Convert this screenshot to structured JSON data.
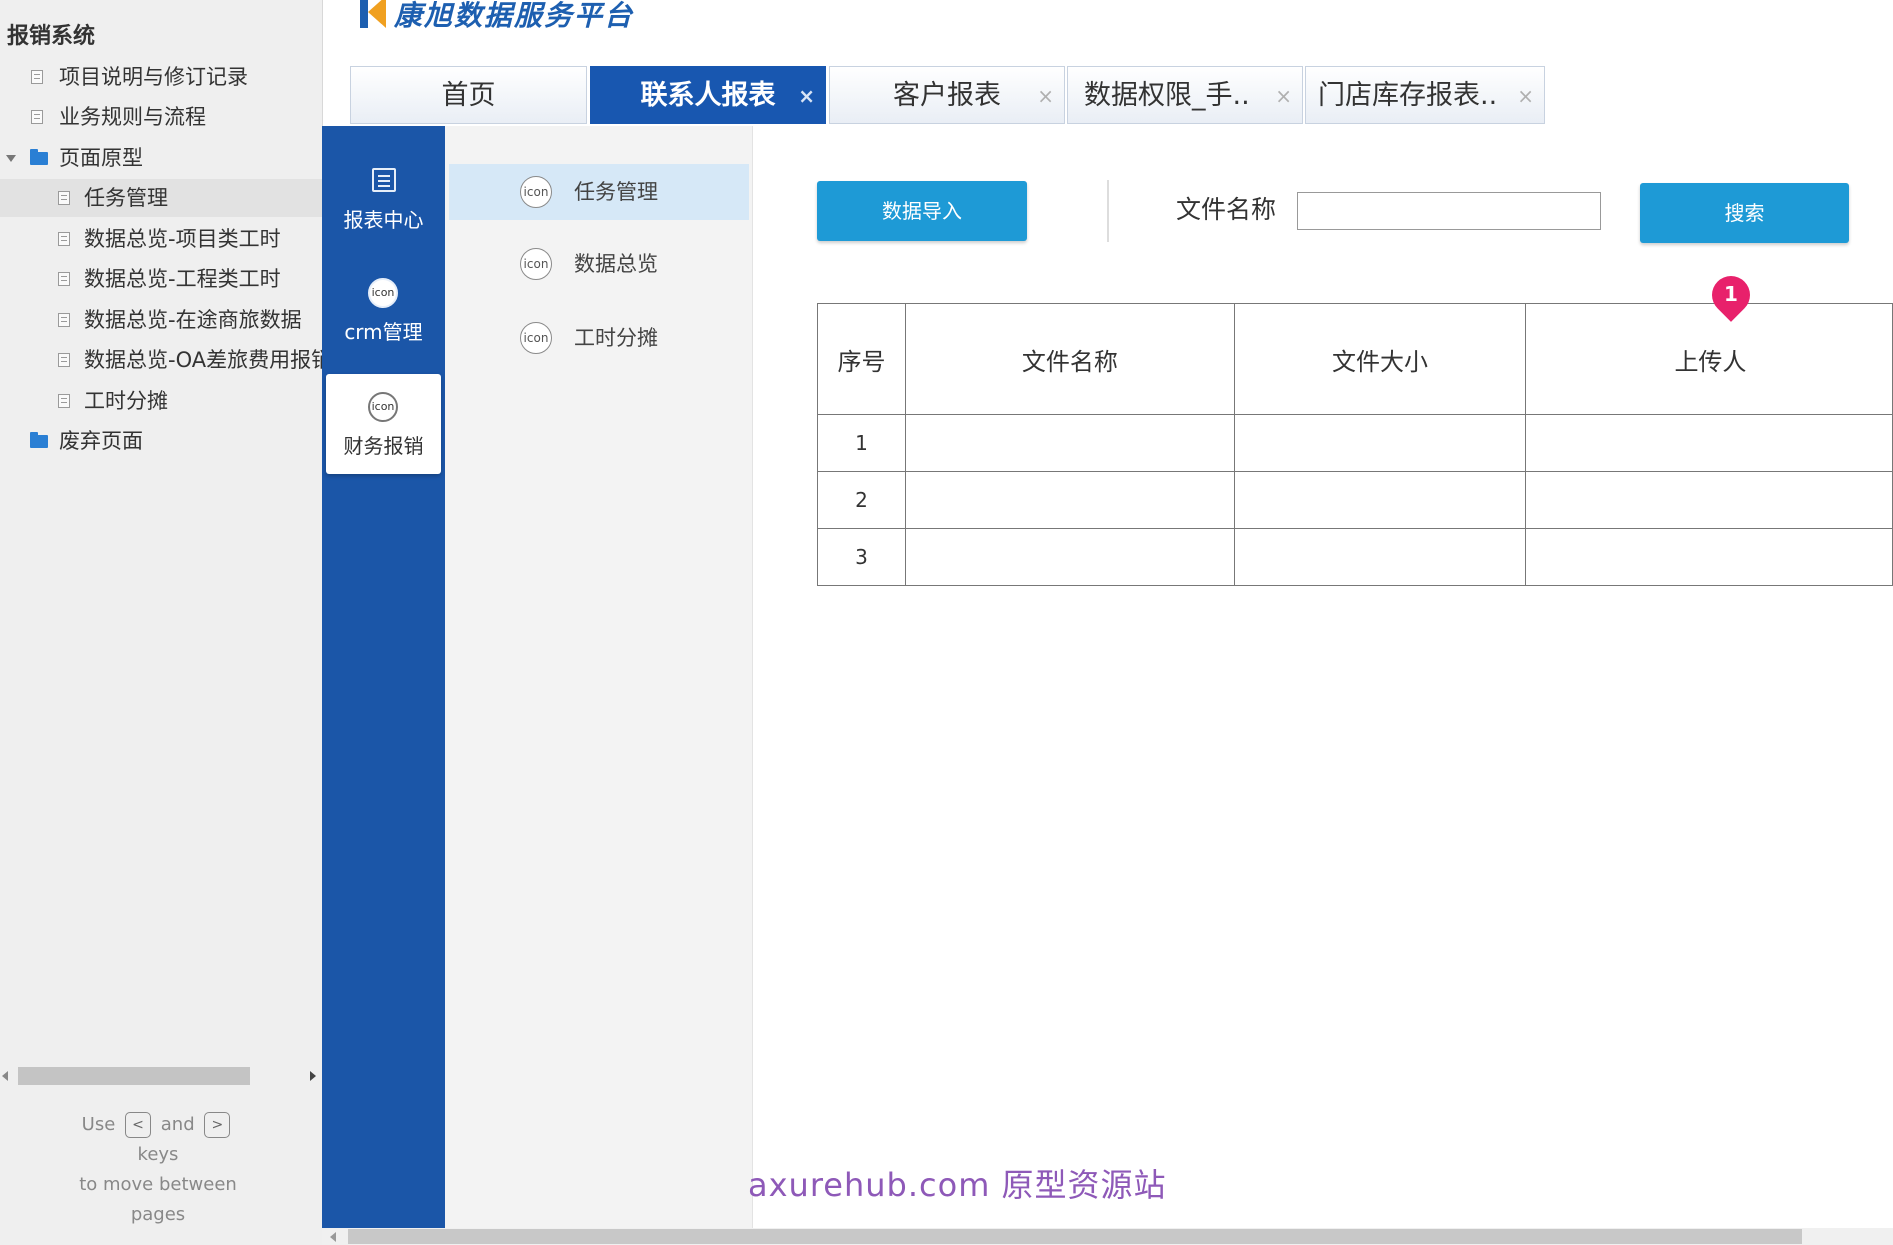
{
  "sitemap": {
    "title": "报销系统",
    "items": [
      {
        "label": "项目说明与修订记录",
        "type": "page"
      },
      {
        "label": "业务规则与流程",
        "type": "page"
      },
      {
        "label": "页面原型",
        "type": "folder"
      },
      {
        "label": "任务管理",
        "type": "page",
        "selected": true
      },
      {
        "label": "数据总览-项目类工时",
        "type": "page"
      },
      {
        "label": "数据总览-工程类工时",
        "type": "page"
      },
      {
        "label": "数据总览-在途商旅数据",
        "type": "page"
      },
      {
        "label": "数据总览-OA差旅费用报销",
        "type": "page"
      },
      {
        "label": "工时分摊",
        "type": "page"
      },
      {
        "label": "废弃页面",
        "type": "folder"
      }
    ],
    "hint": {
      "use": "Use",
      "key_prev": "<",
      "and": "and",
      "key_next": ">",
      "keys": "keys",
      "line3": "to move between",
      "line4": "pages"
    }
  },
  "app": {
    "logo_text": "康旭数据服务平台",
    "tabs": [
      {
        "label": "首页",
        "closable": false,
        "active": false
      },
      {
        "label": "联系人报表",
        "closable": true,
        "active": true
      },
      {
        "label": "客户报表",
        "closable": true,
        "active": false
      },
      {
        "label": "数据权限_手..",
        "closable": true,
        "active": false
      },
      {
        "label": "门店库存报表..",
        "closable": true,
        "active": false
      }
    ],
    "tab_close_glyph": "×",
    "sidenav": [
      {
        "label": "报表中心",
        "icon": "list-icon"
      },
      {
        "label": "crm管理",
        "icon": "icon"
      },
      {
        "label": "财务报销",
        "icon": "icon",
        "active": true
      }
    ],
    "icon_text": "icon",
    "submenu": [
      {
        "label": "任务管理",
        "active": true
      },
      {
        "label": "数据总览"
      },
      {
        "label": "工时分摊"
      }
    ],
    "toolbar": {
      "import_label": "数据导入",
      "filename_label": "文件名称",
      "filename_value": "",
      "search_label": "搜索"
    },
    "table": {
      "headers": [
        "序号",
        "文件名称",
        "文件大小",
        "上传人"
      ],
      "rows": [
        [
          "1",
          "",
          "",
          ""
        ],
        [
          "2",
          "",
          "",
          ""
        ],
        [
          "3",
          "",
          "",
          ""
        ]
      ]
    },
    "annotation_number": "1",
    "watermark": "axurehub.com 原型资源站"
  },
  "colors": {
    "primary_blue": "#1b56a8",
    "button_blue": "#1e9ad6",
    "annotation_pink": "#e8216b",
    "watermark_purple": "#8e59b8"
  }
}
